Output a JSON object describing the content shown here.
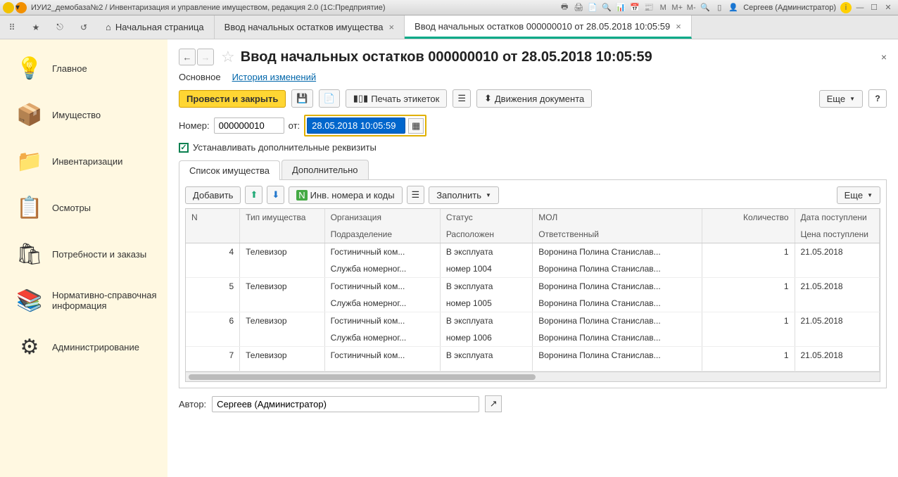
{
  "titlebar": {
    "title": "ИУИ2_демобаза№2 / Инвентаризация и управление имуществом, редакция 2.0  (1С:Предприятие)",
    "user": "Сергеев (Администратор)"
  },
  "tabs": {
    "home": "Начальная страница",
    "tab1": "Ввод начальных остатков имущества",
    "tab2": "Ввод начальных остатков 000000010 от 28.05.2018 10:05:59"
  },
  "sidebar": {
    "items": [
      {
        "label": "Главное",
        "icon": "💡"
      },
      {
        "label": "Имущество",
        "icon": "📦"
      },
      {
        "label": "Инвентаризации",
        "icon": "📁"
      },
      {
        "label": "Осмотры",
        "icon": "📋"
      },
      {
        "label": "Потребности и заказы",
        "icon": "🛍"
      },
      {
        "label": "Нормативно-справочная информация",
        "icon": "📚"
      },
      {
        "label": "Администрирование",
        "icon": "⚙"
      }
    ]
  },
  "doc": {
    "title": "Ввод начальных остатков 000000010 от 28.05.2018 10:05:59",
    "inner_tabs": {
      "main": "Основное",
      "history": "История изменений"
    },
    "toolbar": {
      "post_close": "Провести и закрыть",
      "print_labels": "Печать этикеток",
      "doc_moves": "Движения документа",
      "more": "Еще"
    },
    "fields": {
      "number_label": "Номер:",
      "number_value": "000000010",
      "from_label": "от:",
      "date_value": "28.05.2018 10:05:59",
      "checkbox_label": "Устанавливать дополнительные реквизиты"
    },
    "subtabs": {
      "list": "Список имущества",
      "extra": "Дополнительно"
    },
    "table_toolbar": {
      "add": "Добавить",
      "inv_codes": "Инв. номера и коды",
      "fill": "Заполнить",
      "more": "Еще"
    },
    "columns": {
      "n": "N",
      "type": "Тип имущества",
      "org": "Организация",
      "div": "Подразделение",
      "status": "Статус",
      "loc": "Расположен",
      "mol": "МОЛ",
      "resp": "Ответственный",
      "qty": "Количество",
      "date_in": "Дата поступлени",
      "price_in": "Цена поступлени"
    },
    "rows": [
      {
        "n": "4",
        "type": "Телевизор",
        "org": "Гостиничный ком...",
        "div": "Служба номерног...",
        "status": "В эксплуата",
        "loc": "номер 1004",
        "mol": "Воронина Полина Станислав...",
        "resp": "Воронина Полина Станислав...",
        "qty": "1",
        "date": "21.05.2018"
      },
      {
        "n": "5",
        "type": "Телевизор",
        "org": "Гостиничный ком...",
        "div": "Служба номерног...",
        "status": "В эксплуата",
        "loc": "номер 1005",
        "mol": "Воронина Полина Станислав...",
        "resp": "Воронина Полина Станислав...",
        "qty": "1",
        "date": "21.05.2018"
      },
      {
        "n": "6",
        "type": "Телевизор",
        "org": "Гостиничный ком...",
        "div": "Служба номерног...",
        "status": "В эксплуата",
        "loc": "номер 1006",
        "mol": "Воронина Полина Станислав...",
        "resp": "Воронина Полина Станислав...",
        "qty": "1",
        "date": "21.05.2018"
      },
      {
        "n": "7",
        "type": "Телевизор",
        "org": "Гостиничный ком...",
        "div": "",
        "status": "В эксплуата",
        "loc": "",
        "mol": "Воронина Полина Станислав...",
        "resp": "",
        "qty": "1",
        "date": "21.05.2018"
      }
    ],
    "footer": {
      "author_label": "Автор:",
      "author_value": "Сергеев (Администратор)"
    }
  }
}
